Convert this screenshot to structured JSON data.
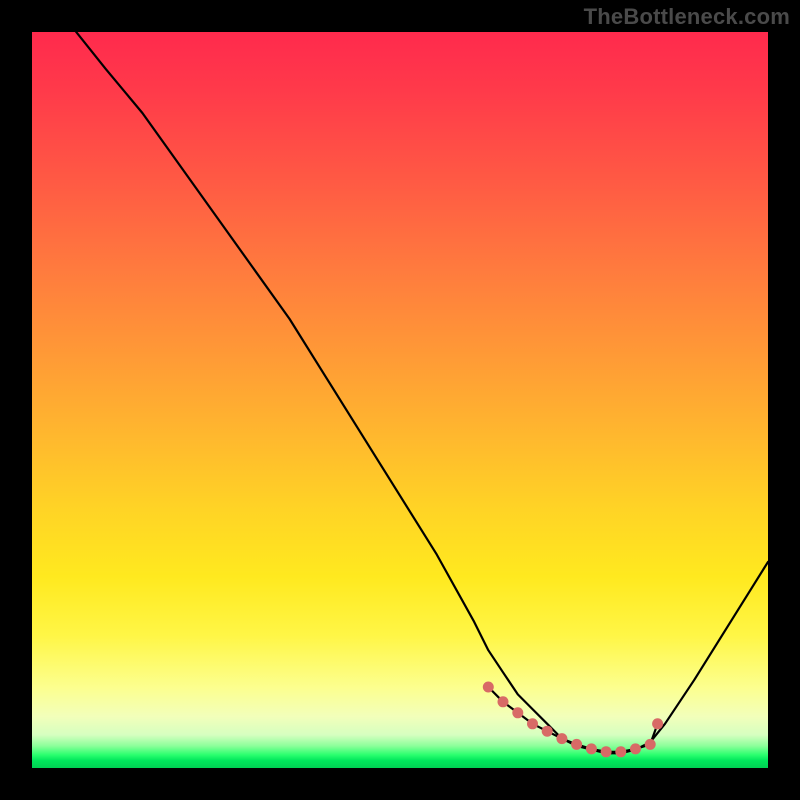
{
  "watermark": "TheBottleneck.com",
  "colors": {
    "background": "#000000",
    "curve": "#000000",
    "marker": "#d86a66"
  },
  "chart_data": {
    "type": "line",
    "title": "",
    "xlabel": "",
    "ylabel": "",
    "xlim": [
      0,
      100
    ],
    "ylim": [
      0,
      100
    ],
    "grid": false,
    "legend": false,
    "x": [
      6,
      10,
      15,
      20,
      25,
      30,
      35,
      40,
      45,
      50,
      55,
      60,
      62,
      64,
      66,
      68,
      70,
      72,
      74,
      76,
      78,
      80,
      82,
      84,
      86,
      90,
      95,
      100
    ],
    "y": [
      100,
      95,
      89,
      82,
      75,
      68,
      61,
      53,
      45,
      37,
      29,
      20,
      16,
      13,
      10,
      8,
      6,
      4,
      3,
      2.5,
      2,
      2,
      2.5,
      3.5,
      6,
      12,
      20,
      28
    ],
    "markers": {
      "x": [
        62,
        64,
        66,
        68,
        70,
        72,
        74,
        76,
        78,
        80,
        82,
        84,
        85
      ],
      "y": [
        11,
        9,
        7.5,
        6,
        5,
        4,
        3.2,
        2.6,
        2.2,
        2.2,
        2.6,
        3.2,
        6
      ]
    },
    "note": "x and y are in percent of the plot area; y=0 is bottom, 100 is top. Values are read off the image — the curve descends roughly linearly from top-left, bottoms out with a flat plateau around x≈72–82 at y≈2, then rises again to the right."
  }
}
